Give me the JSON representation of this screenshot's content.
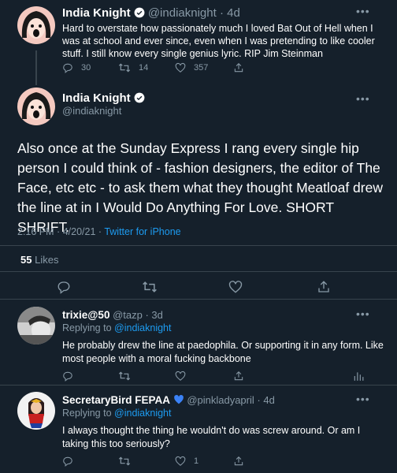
{
  "tweet1": {
    "name": "India Knight",
    "handle": "@indiaknight",
    "age": "4d",
    "text": "Hard to overstate how passionately much I loved Bat Out of Hell when I was at school and ever since, even when I was pretending to like cooler stuff. I still know every single genius lyric. RIP Jim Steinman",
    "replies": "30",
    "retweets": "14",
    "likes": "357"
  },
  "main": {
    "name": "India Knight",
    "handle": "@indiaknight",
    "text": "Also once at the Sunday Express I rang every single hip person I could think of - fashion designers, the editor of The Face, etc etc - to ask them what they thought Meatloaf drew the line at in I Would Do Anything For Love. SHORT SHRIFT.",
    "time": "2:16 PM",
    "date": "4/20/21",
    "separator": "·",
    "source": "Twitter for iPhone",
    "likes_count": "55",
    "likes_label": "Likes"
  },
  "reply1": {
    "name": "trixie@50",
    "handle": "@tazp",
    "age": "3d",
    "replying_prefix": "Replying to",
    "replying_to": "@indiaknight",
    "text": "He probably drew the line at paedophila. Or supporting it in any form. Like most people with a moral fucking backbone"
  },
  "reply2": {
    "name": "SecretaryBird FEPAA",
    "handle": "@pinkladyapril",
    "age": "4d",
    "replying_prefix": "Replying to",
    "replying_to": "@indiaknight",
    "text": "I always thought the thing he wouldn't do was screw around. Or am I taking this too seriously?",
    "likes": "1"
  },
  "colors": {
    "background": "#15202b",
    "accent": "#1d9bf0",
    "muted": "#8899a6",
    "divider": "#38444d"
  },
  "icons": [
    "reply-icon",
    "retweet-icon",
    "like-icon",
    "share-icon",
    "more-icon",
    "verified-icon",
    "analytics-icon",
    "blue-heart-icon"
  ]
}
